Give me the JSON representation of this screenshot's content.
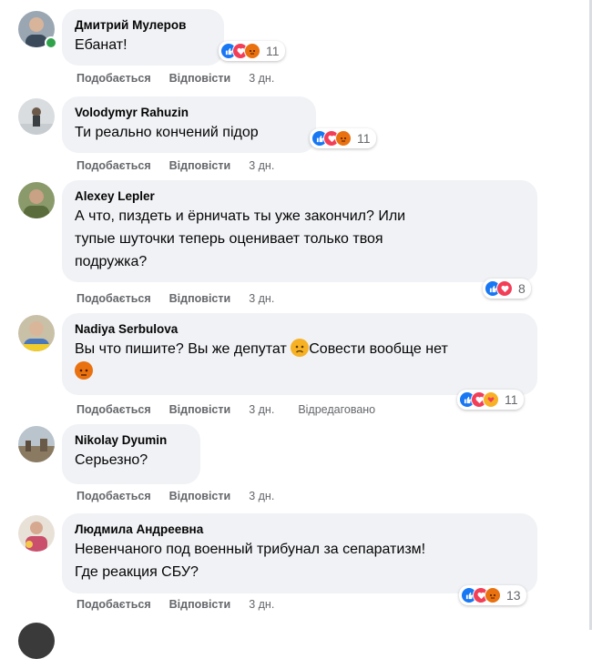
{
  "colors": {
    "like": "#1877f2",
    "love": "#f33e58",
    "angry": "#e9710f",
    "care": "#f7b125",
    "online": "#31a24c"
  },
  "actions": {
    "like": "Подобається",
    "reply": "Відповісти"
  },
  "comments": [
    {
      "author": "Дмитрий Мулеров",
      "lines": [
        "Ебанат!"
      ],
      "reactions": [
        "like-icon",
        "love-icon",
        "angry-icon"
      ],
      "count": "11",
      "time": "3 дн.",
      "edited": ""
    },
    {
      "author": "Volodymyr Rahuzin",
      "lines": [
        "Ти реально кончений підор"
      ],
      "reactions": [
        "like-icon",
        "love-icon",
        "angry-icon"
      ],
      "count": "11",
      "time": "3 дн.",
      "edited": ""
    },
    {
      "author": "Alexey Lepler",
      "lines": [
        "А что, пиздеть и ёрничать ты уже закончил? Или",
        "тупые шуточки теперь оценивает только твоя",
        "подружка?"
      ],
      "reactions": [
        "like-icon",
        "love-icon"
      ],
      "count": "8",
      "time": "3 дн.",
      "edited": ""
    },
    {
      "author": "Nadiya Serbulova",
      "lines": [
        "Вы что пишите? Вы же депутат",
        "Совести вообще нет"
      ],
      "reactions": [
        "like-icon",
        "love-icon",
        "care-icon"
      ],
      "count": "11",
      "time": "3 дн.",
      "edited": "Відредаговано"
    },
    {
      "author": "Nikolay Dyumin",
      "lines": [
        "Серьезно?"
      ],
      "reactions": [],
      "count": "",
      "time": "3 дн.",
      "edited": ""
    },
    {
      "author": "Людмила Андреевна",
      "lines": [
        "Невенчаного под военный трибунал за сепаратизм!",
        "Где реакция СБУ?"
      ],
      "reactions": [
        "like-icon",
        "love-icon",
        "angry-icon"
      ],
      "count": "13",
      "time": "3 дн.",
      "edited": ""
    }
  ]
}
